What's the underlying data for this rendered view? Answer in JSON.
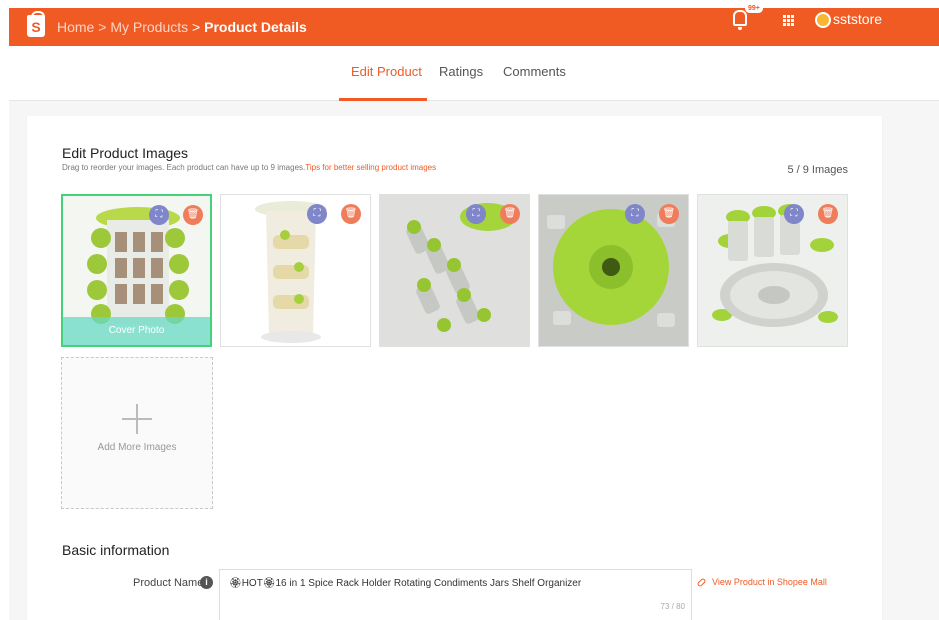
{
  "header": {
    "breadcrumb": {
      "home": "Home",
      "sep1": ">",
      "products": "My Products",
      "sep2": ">",
      "current": "Product Details"
    },
    "notification_badge": "99+",
    "username": "sststore",
    "colors": {
      "brand": "#f05a23"
    },
    "icons": [
      "shopee-bag-icon",
      "bell-icon",
      "apps-grid-icon",
      "avatar"
    ]
  },
  "tabs": [
    {
      "label": "Edit Product",
      "active": true
    },
    {
      "label": "Ratings",
      "active": false
    },
    {
      "label": "Comments",
      "active": false
    }
  ],
  "images_section": {
    "title": "Edit Product Images",
    "hint": "Drag to reorder your images. Each product can have up to 9 images.",
    "hint_link": "Tips for better selling product images",
    "count": "5 / 9 Images",
    "cover_label": "Cover Photo",
    "add_more_label": "Add More Images"
  },
  "basic_info": {
    "title": "Basic information",
    "product_name_label": "Product Name",
    "product_name_value": "🏵HOT🏵16 in 1 Spice Rack Holder Rotating Condiments Jars Shelf Organizer",
    "char_count": "73 / 80",
    "view_link": "View Product in Shopee Mall"
  }
}
